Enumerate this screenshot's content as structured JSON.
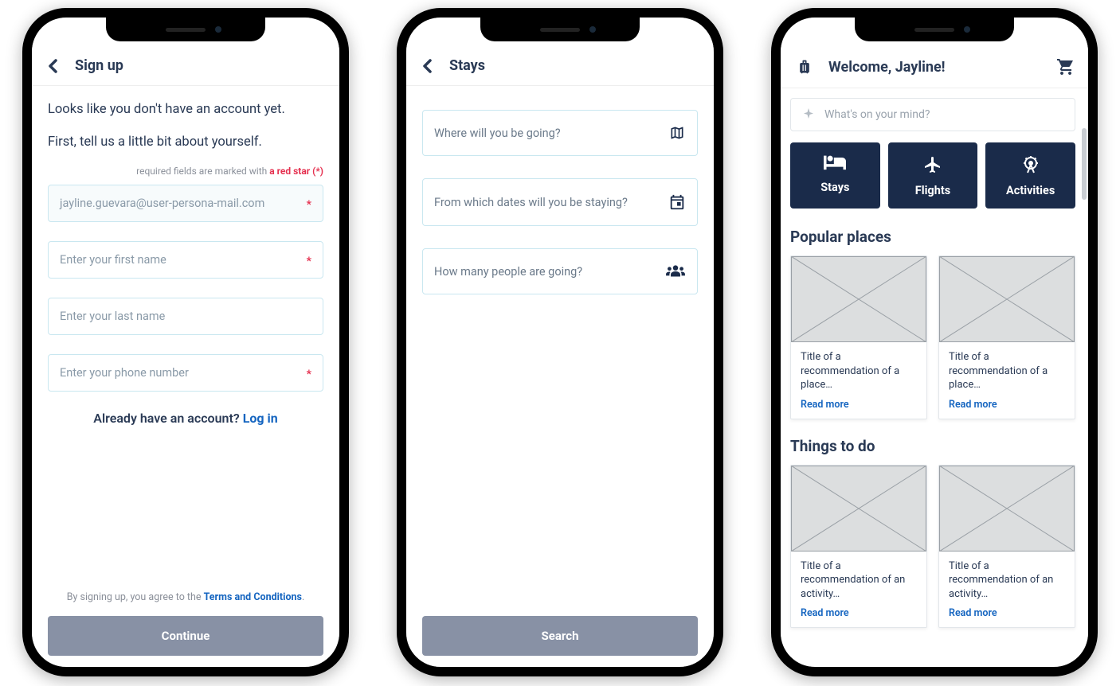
{
  "screen1": {
    "title": "Sign up",
    "intro1": "Looks like you don't have an account yet.",
    "intro2": "First, tell us a little bit about yourself.",
    "required_prefix": "required fields are marked with ",
    "required_red": "a red star (*)",
    "email_value": "jayline.guevara@user-persona-mail.com",
    "first_name_placeholder": "Enter your first name",
    "last_name_placeholder": "Enter your last name",
    "phone_placeholder": "Enter your phone number",
    "already_text": "Already have an account? ",
    "login_link": "Log in",
    "terms_prefix": "By signing up, you agree to the ",
    "terms_link": "Terms and Conditions",
    "terms_suffix": ".",
    "cta": "Continue"
  },
  "screen2": {
    "title": "Stays",
    "where_placeholder": "Where will you be going?",
    "dates_placeholder": "From which dates will you be staying?",
    "people_placeholder": "How many people are going?",
    "cta": "Search"
  },
  "screen3": {
    "welcome": "Welcome, Jayline!",
    "search_placeholder": "What's on your mind?",
    "categories": {
      "stays": "Stays",
      "flights": "Flights",
      "activities": "Activities"
    },
    "popular_title": "Popular places",
    "things_title": "Things to do",
    "place_card_title": "Title of a recommendation of a place…",
    "activity_card_title": "Title of a recommendation of an activity…",
    "read_more": "Read more"
  }
}
